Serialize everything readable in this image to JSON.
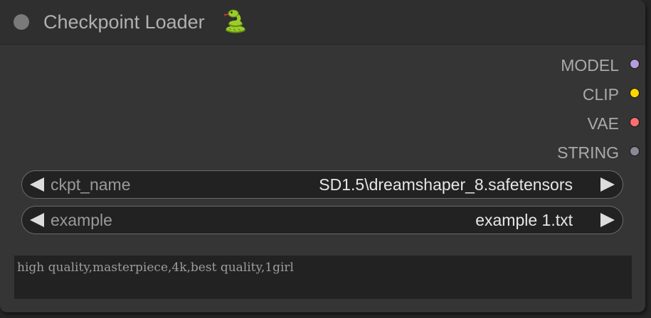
{
  "node": {
    "title": "Checkpoint Loader",
    "title_icon": "snake-emoji-icon",
    "outputs": [
      {
        "label": "MODEL",
        "color": "#b39ddb"
      },
      {
        "label": "CLIP",
        "color": "#ffd500"
      },
      {
        "label": "VAE",
        "color": "#ff6e6e"
      },
      {
        "label": "STRING",
        "color": "#8a8a96"
      }
    ],
    "widgets": {
      "ckpt_name": {
        "label": "ckpt_name",
        "value": "SD1.5\\dreamshaper_8.safetensors"
      },
      "example": {
        "label": "example",
        "value": "example 1.txt"
      }
    },
    "text_value": "high quality,masterpiece,4k,best quality,1girl"
  }
}
